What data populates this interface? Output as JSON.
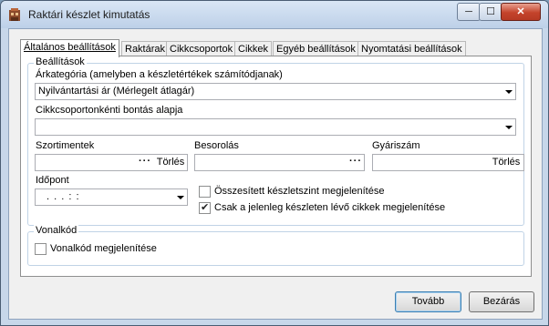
{
  "window": {
    "title": "Raktári készlet kimutatás",
    "minimize_glyph": "─",
    "maximize_glyph": "☐",
    "close_glyph": "✕"
  },
  "tabs": [
    {
      "label": "Általános beállítások",
      "active": true
    },
    {
      "label": "Raktárak"
    },
    {
      "label": "Cikkcsoportok"
    },
    {
      "label": "Cikkek"
    },
    {
      "label": "Egyéb beállítások"
    },
    {
      "label": "Nyomtatási beállítások"
    }
  ],
  "settings": {
    "group_title": "Beállítások",
    "price_category_label": "Árkategória (amelyben a készletértékek számítódjanak)",
    "price_category_value": "Nyilvántartási ár (Mérlegelt átlagár)",
    "breakdown_label": "Cikkcsoportonkénti bontás alapja",
    "breakdown_value": "",
    "assortments_label": "Szortimentek",
    "assortments_value": "",
    "classification_label": "Besorolás",
    "classification_value": "",
    "manufacturer_no_label": "Gyáriszám",
    "manufacturer_no_value": "",
    "dots": "···",
    "clear_label": "Törlés",
    "time_label": "Időpont",
    "time_value": ". . .   : :",
    "cumulative_label": "Összesített készletszint megjelenítése",
    "cumulative_checked": false,
    "in_stock_only_label": "Csak a jelenleg készleten lévő cikkek megjelenítése",
    "in_stock_only_checked": true
  },
  "barcode": {
    "group_title": "Vonalkód",
    "show_label": "Vonalkód megjelenítése",
    "show_checked": false
  },
  "buttons": {
    "next": "Tovább",
    "close": "Bezárás"
  }
}
